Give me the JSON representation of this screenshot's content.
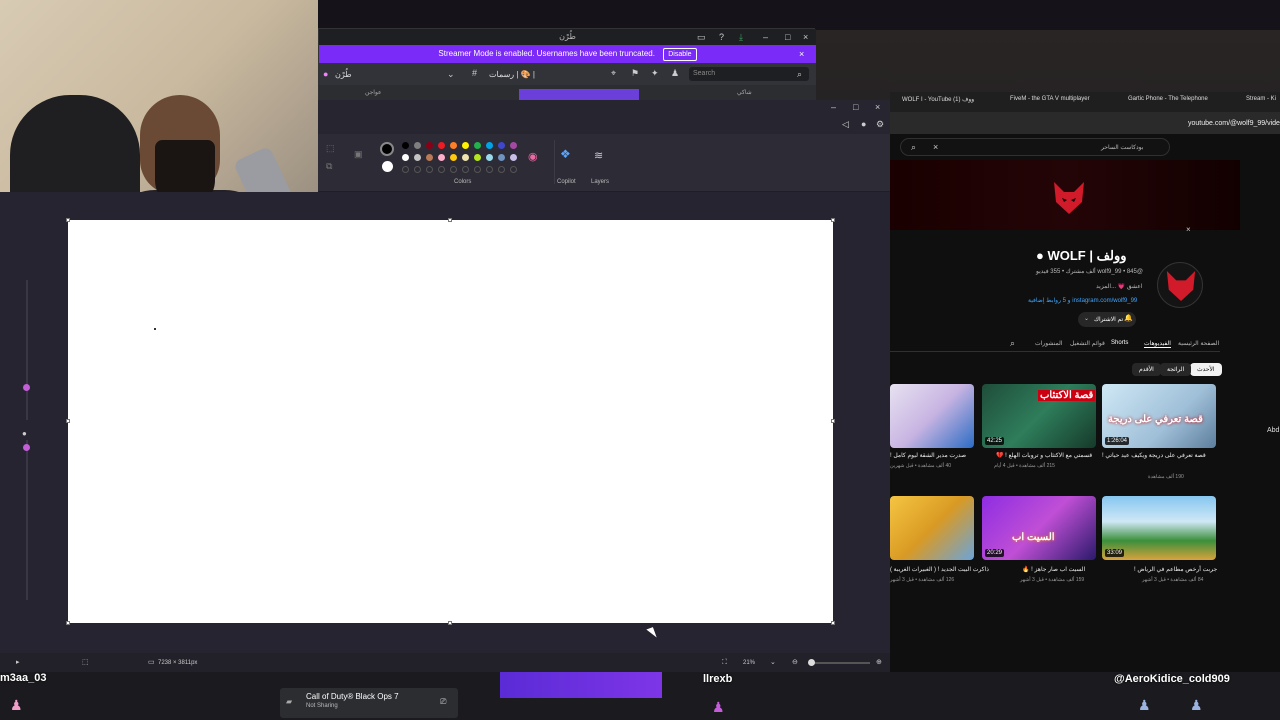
{
  "discord": {
    "window_title": "طُرْن",
    "banner_text": "Streamer Mode is enabled. Usernames have been truncated.",
    "banner_button": "Disable",
    "server_name": "طُرْن",
    "channel_name": "رسمات | 🎨 |",
    "search_placeholder": "Search",
    "subline_left": "عواجن",
    "subline_right": "شاكي"
  },
  "paint": {
    "ribbon": {
      "colors_label": "Colors",
      "copilot_label": "Copilot",
      "layers_label": "Layers"
    },
    "palette_row1": [
      "#000000",
      "#7f7f7f",
      "#880015",
      "#ed1c24",
      "#ff7f27",
      "#fff200",
      "#22b14c",
      "#00a2e8",
      "#3f48cc",
      "#a349a4"
    ],
    "palette_row2": [
      "#ffffff",
      "#c3c3c3",
      "#b97a57",
      "#ffaec9",
      "#ffc90e",
      "#efe4b0",
      "#b5e61d",
      "#99d9ea",
      "#7092be",
      "#c8bfe7"
    ],
    "status": {
      "canvas_size": "7238 × 3811px",
      "zoom": "21%"
    }
  },
  "youtube": {
    "tabs": [
      "WOLF I - YouTube ووف (1)",
      "FiveM - the GTA V multiplayer",
      "Gartic Phone - The Telephone",
      "Stream - Ki"
    ],
    "url": "youtube.com/@wolf9_99/vide",
    "search_hint": "بودكاست الساحر",
    "channel_name": "وولف | WOLF ●",
    "handle_line": "@wolf9_99 • 845 ألف مشترك • 355 فيديو",
    "desc_line": "اعشق 💗 ...المزيد",
    "link_line": "instagram.com/wolf9_99 و 5 روابط إضافية",
    "subscribe_label": "تم الاشتراك",
    "nav_tabs": [
      "الصفحة الرئيسية",
      "الفيديوهات",
      "Shorts",
      "قوائم التشغيل",
      "المنشورات"
    ],
    "chips": [
      "الأحدث",
      "الرائجة",
      "الأقدم"
    ],
    "videos_row1": [
      {
        "title": "قصة تعرفي على دريجة ويكيف عيد حياتي !",
        "meta": "190 ألف مشاهدة",
        "duration": "1:26:04"
      },
      {
        "title": "قسمتي مع الاكتئاب و تروبات الهلع ! 💔",
        "meta": "215 ألف مشاهدة • قبل 4 أيام",
        "duration": "42:25"
      },
      {
        "title": "صدرت مدير الشقة ليوم كامل !",
        "meta": "40 ألف مشاهدة • قبل شهرين",
        "duration": ""
      }
    ],
    "videos_row2": [
      {
        "title": "جربت أرخص مطاعم في الرياض !",
        "meta": "84 ألف مشاهدة • قبل 3 أشهر",
        "duration": "33:09"
      },
      {
        "title": "السيت اب صار جاهز ! 🔥",
        "meta": "159 ألف مشاهدة • قبل 3 أشهر",
        "duration": "20:29"
      },
      {
        "title": "ذاكرت البيت الجديد ! ( الغبيرات الغريبة )",
        "meta": "126 ألف مشاهدة • قبل 3 أشهر",
        "duration": ""
      }
    ],
    "thumb_text_1": "قصة تعرفي على دريجة",
    "thumb_text_2": "قصة الاكتئاب",
    "thumb_text_3": "السيت اب"
  },
  "bottom": {
    "user_left": "m3aa_03",
    "user_mid": "llrexb",
    "user_right": "@AeroKidice_cold909",
    "game_title": "Call of Duty® Black Ops 7",
    "game_status": "Not Sharing",
    "side_label": "Abd"
  }
}
